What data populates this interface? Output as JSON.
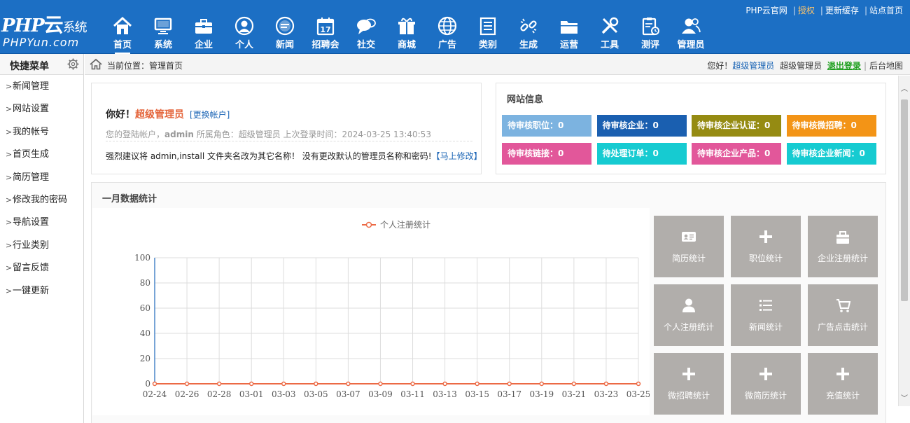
{
  "logo": {
    "main": "PHP",
    "yun": "云",
    "sys": "系统",
    "sub": "PHPYun.com"
  },
  "nav": [
    {
      "label": "首页",
      "icon": "home-icon"
    },
    {
      "label": "系统",
      "icon": "monitor-icon"
    },
    {
      "label": "企业",
      "icon": "briefcase-icon"
    },
    {
      "label": "个人",
      "icon": "user-icon"
    },
    {
      "label": "新闻",
      "icon": "news-icon"
    },
    {
      "label": "招聘会",
      "icon": "calendar-icon"
    },
    {
      "label": "社交",
      "icon": "chat-icon"
    },
    {
      "label": "商城",
      "icon": "gift-icon"
    },
    {
      "label": "广告",
      "icon": "globe-icon"
    },
    {
      "label": "类别",
      "icon": "list-icon"
    },
    {
      "label": "生成",
      "icon": "link-icon"
    },
    {
      "label": "运营",
      "icon": "folder-icon"
    },
    {
      "label": "工具",
      "icon": "tools-icon"
    },
    {
      "label": "测评",
      "icon": "clipboard-icon"
    },
    {
      "label": "管理员",
      "icon": "admins-icon"
    }
  ],
  "toplinks": {
    "official": "PHP云官网",
    "license": "授权",
    "cache": "更新缓存",
    "site_home": "站点首页"
  },
  "sidebar": {
    "title": "快捷菜单",
    "items": [
      "新闻管理",
      "网站设置",
      "我的帐号",
      "首页生成",
      "简历管理",
      "修改我的密码",
      "导航设置",
      "行业类别",
      "留言反馈",
      "一键更新"
    ]
  },
  "breadcrumb": {
    "location": "当前位置：管理首页",
    "greeting": "您好！",
    "user_link": "超级管理员",
    "role": "超级管理员",
    "logout": "退出登录",
    "sitemap": "后台地图"
  },
  "welcome": {
    "hello": "你好！",
    "name": "超级管理员",
    "switch": "[更换帐户]",
    "info_prefix": "您的登陆帐户，",
    "account": "admin",
    "info_mid": " 所属角色：超级管理员 上次登录时间：2024-03-25 13:40:53",
    "warning": "强烈建议将 admin,install 文件夹名改为其它名称！ 没有更改默认的管理员名称和密码!",
    "fix": "【马上修改】"
  },
  "siteinfo": {
    "title": "网站信息",
    "tiles": [
      {
        "label": "待审核职位：0",
        "color": "#7cb3e0"
      },
      {
        "label": "待审核企业：0",
        "color": "#1a5fb0"
      },
      {
        "label": "待审核企业认证：0",
        "color": "#958b12"
      },
      {
        "label": "待审核微招聘：0",
        "color": "#f39416"
      },
      {
        "label": "待审核链接：0",
        "color": "#e2579a"
      },
      {
        "label": "待处理订单：0",
        "color": "#16cbd1"
      },
      {
        "label": "待审核企业产品：0",
        "color": "#e2579a"
      },
      {
        "label": "待审核企业新闻：0",
        "color": "#16cbd1"
      }
    ]
  },
  "monthly": {
    "title": "一月数据统计",
    "quick": [
      {
        "label": "简历统计",
        "icon": "id-card-icon"
      },
      {
        "label": "职位统计",
        "icon": "plus-icon"
      },
      {
        "label": "企业注册统计",
        "icon": "bag-icon"
      },
      {
        "label": "个人注册统计",
        "icon": "person-icon"
      },
      {
        "label": "新闻统计",
        "icon": "list-icon"
      },
      {
        "label": "广告点击统计",
        "icon": "cart-icon"
      },
      {
        "label": "微招聘统计",
        "icon": "plus-icon"
      },
      {
        "label": "微简历统计",
        "icon": "plus-icon"
      },
      {
        "label": "充值统计",
        "icon": "plus-icon"
      }
    ]
  },
  "chart_data": {
    "type": "line",
    "legend": "top-center",
    "grid": true,
    "x": [
      "02-24",
      "02-26",
      "02-28",
      "03-01",
      "03-03",
      "03-05",
      "03-07",
      "03-09",
      "03-11",
      "03-13",
      "03-15",
      "03-17",
      "03-19",
      "03-21",
      "03-23",
      "03-25"
    ],
    "series": [
      {
        "name": "个人注册统计",
        "color": "#ec6a45",
        "values": [
          0,
          0,
          0,
          0,
          0,
          0,
          0,
          0,
          0,
          0,
          0,
          0,
          0,
          0,
          0,
          0
        ]
      }
    ],
    "yticks": [
      0,
      20,
      40,
      60,
      80,
      100
    ],
    "ylim": [
      0,
      100
    ]
  }
}
